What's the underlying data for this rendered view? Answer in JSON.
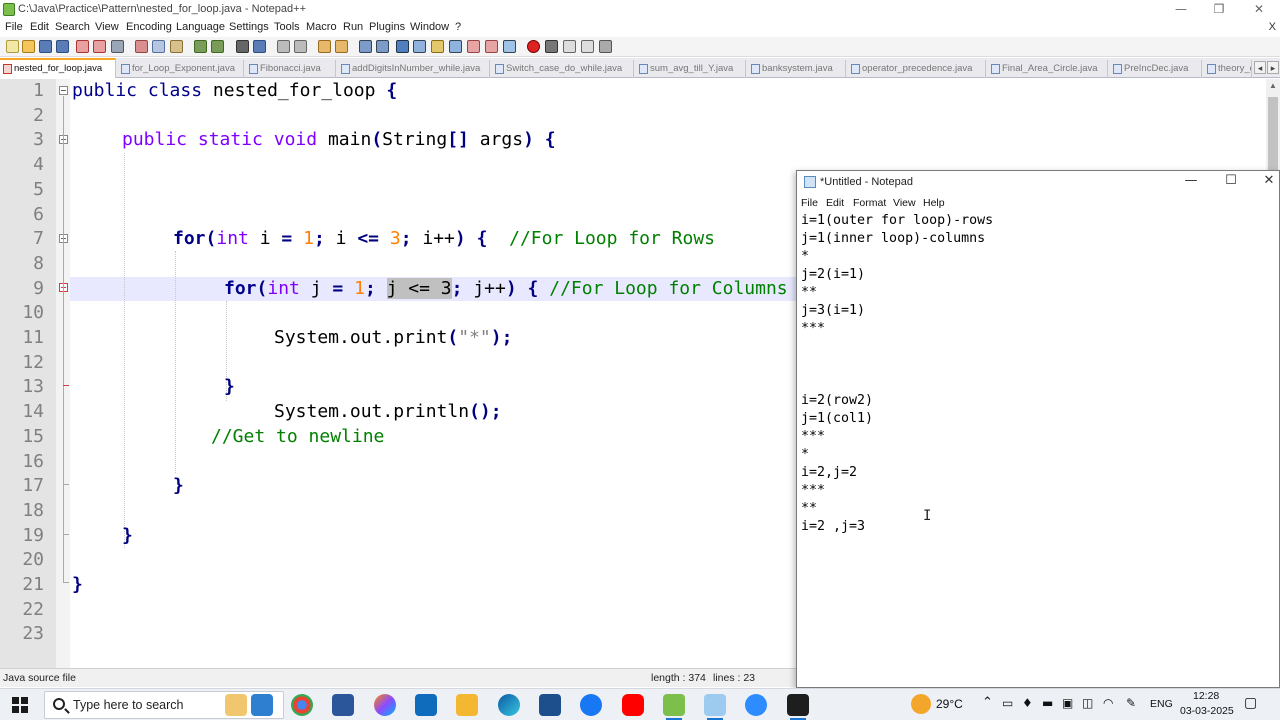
{
  "npp": {
    "title": "C:\\Java\\Practice\\Pattern\\nested_for_loop.java - Notepad++",
    "win_minimize": "—",
    "win_maximize": "❐",
    "win_close": "✕",
    "menu": [
      "File",
      "Edit",
      "Search",
      "View",
      "Encoding",
      "Language",
      "Settings",
      "Tools",
      "Macro",
      "Run",
      "Plugins",
      "Window",
      "?"
    ],
    "menu_close": "X",
    "tabs": [
      "nested_for_loop.java",
      "for_Loop_Exponent.java",
      "Fibonacci.java",
      "addDigitsInNumber_while.java",
      "Switch_case_do_while.java",
      "sum_avg_till_Y.java",
      "banksystem.java",
      "operator_precedence.java",
      "Final_Area_Circle.java",
      "PreIncDec.java",
      "theory_c"
    ],
    "tab_prev": "◂",
    "tab_next": "▸",
    "line_numbers": [
      "1",
      "2",
      "3",
      "4",
      "5",
      "6",
      "7",
      "8",
      "9",
      "10",
      "11",
      "12",
      "13",
      "14",
      "15",
      "16",
      "17",
      "18",
      "19",
      "20",
      "21",
      "22",
      "23"
    ],
    "code": {
      "l1_a": "public",
      "l1_b": "class",
      "l1_c": "nested_for_loop",
      "l1_d": "{",
      "l3_a": "public",
      "l3_b": "static",
      "l3_c": "void",
      "l3_d": "main",
      "l3_e": "(",
      "l3_f": "String",
      "l3_g": "[]",
      "l3_h": "args",
      "l3_i": ")",
      "l3_j": "{",
      "l7_for": "for",
      "l7_p1": "(",
      "l7_int": "int",
      "l7_i": "i",
      "l7_eq": "=",
      "l7_1": "1",
      "l7_s1": ";",
      "l7_i2": "i",
      "l7_le": "<=",
      "l7_3": "3",
      "l7_s2": ";",
      "l7_inc": "i++",
      "l7_p2": ")",
      "l7_br": "{",
      "l7_cm": "//For Loop for Rows",
      "l9_for": "for",
      "l9_p1": "(",
      "l9_int": "int",
      "l9_j": "j",
      "l9_eq": "=",
      "l9_1": "1",
      "l9_s1": ";",
      "l9_sel": "j <= 3",
      "l9_s2": ";",
      "l9_inc": "j++",
      "l9_p2": ")",
      "l9_br": "{",
      "l9_cm": "//For Loop for Columns",
      "l11_a": "System.out.print",
      "l11_b": "(",
      "l11_c": "\"*\"",
      "l11_d": ")",
      "l11_e": ";",
      "l13": "}",
      "l14_a": "System.out.println",
      "l14_b": "();",
      "l15": "//Get to newline",
      "l17": "}",
      "l19": "}",
      "l21": "}"
    },
    "status": {
      "lang": "Java source file",
      "length": "length : 374",
      "lines": "lines : 23"
    }
  },
  "notepad": {
    "title": "*Untitled - Notepad",
    "ctl_min": "—",
    "ctl_max": "☐",
    "ctl_close": "✕",
    "menu": [
      "File",
      "Edit",
      "Format",
      "View",
      "Help"
    ],
    "lines": [
      "i=1(outer for loop)-rows",
      "j=1(inner loop)-columns",
      "*",
      "j=2(i=1)",
      "**",
      "j=3(i=1)",
      "***",
      "",
      "",
      "",
      "i=2(row2)",
      "j=1(col1)",
      "***",
      "*",
      "i=2,j=2",
      "***",
      "**",
      "i=2 ,j=3"
    ]
  },
  "taskbar": {
    "search_placeholder": "Type here to search",
    "temperature": "29°C",
    "language": "ENG",
    "time": "12:28",
    "date": "03-03-2025"
  }
}
